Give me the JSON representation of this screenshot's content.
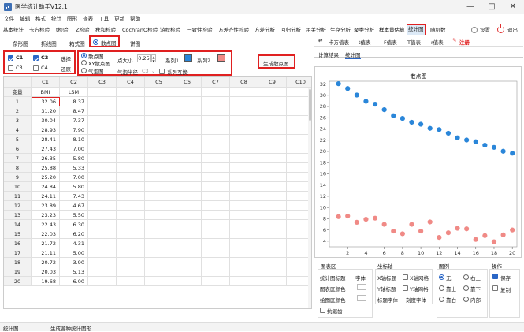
{
  "app": {
    "title": "医学统计助手V12.1"
  },
  "window_controls": {
    "minimize": "—",
    "maximize": "□",
    "close": "✕"
  },
  "menu": [
    "文件",
    "编辑",
    "格式",
    "统计",
    "图形",
    "查表",
    "工具",
    "更新",
    "帮助"
  ],
  "toolbar": {
    "items": [
      "基本统计",
      "卡方检验",
      "t检验",
      "Z检验",
      "秩和检验",
      "CochranQ检验",
      "游程检验",
      "一致性检验",
      "方差齐性检验",
      "方差分析",
      "回归分析",
      "相关分析",
      "生存分析",
      "聚类分析",
      "样本量估算",
      "统计图",
      "随机数"
    ],
    "active": "统计图",
    "settings_label": "设置",
    "exit_label": "退出"
  },
  "chart_tabs": {
    "items": [
      "条形图",
      "折线图",
      "箱式图",
      "散点图",
      "饼图"
    ],
    "active": "散点图"
  },
  "options": {
    "c1": "C1",
    "c2": "C2",
    "c3": "C3",
    "c4": "C4",
    "select_label": "选择",
    "restore_label": "还原",
    "type_scatter": "散点图",
    "type_xy": "XY散点图",
    "type_bubble": "气泡图",
    "point_size_label": "点大小",
    "point_size_value": "0.25",
    "series1_label": "系列1",
    "series2_label": "系列2",
    "bubble_radius_label": "气泡半径",
    "bubble_radius_value": "C3",
    "swap_label": "系列互换",
    "generate_label": "生成散点图",
    "series1_color": "#2a86d9",
    "series2_color": "#f08a86"
  },
  "table": {
    "columns": [
      "C1",
      "C2",
      "C3",
      "C4",
      "C5",
      "C6",
      "C7",
      "C8",
      "C9",
      "C10"
    ],
    "var_label": "变量",
    "var_names": [
      "BMI",
      "LSM"
    ],
    "rows": [
      [
        "1",
        "32.06",
        "8.37"
      ],
      [
        "2",
        "31.20",
        "8.47"
      ],
      [
        "3",
        "30.04",
        "7.37"
      ],
      [
        "4",
        "28.93",
        "7.90"
      ],
      [
        "5",
        "28.41",
        "8.10"
      ],
      [
        "6",
        "27.43",
        "7.00"
      ],
      [
        "7",
        "26.35",
        "5.80"
      ],
      [
        "8",
        "25.88",
        "5.33"
      ],
      [
        "9",
        "25.20",
        "7.00"
      ],
      [
        "10",
        "24.84",
        "5.80"
      ],
      [
        "11",
        "24.11",
        "7.43"
      ],
      [
        "12",
        "23.89",
        "4.67"
      ],
      [
        "13",
        "23.23",
        "5.50"
      ],
      [
        "14",
        "22.43",
        "6.30"
      ],
      [
        "15",
        "22.03",
        "6.20"
      ],
      [
        "16",
        "21.72",
        "4.31"
      ],
      [
        "17",
        "21.11",
        "5.00"
      ],
      [
        "18",
        "20.72",
        "3.90"
      ],
      [
        "19",
        "20.03",
        "5.13"
      ],
      [
        "20",
        "19.68",
        "6.00"
      ]
    ]
  },
  "right_panel": {
    "tabs": [
      "卡方值表",
      "t值表",
      "F值表",
      "T值表",
      "r值表"
    ],
    "register_label": "注册",
    "subtabs": [
      "计算结果",
      "统计图"
    ],
    "active_subtab": "统计图"
  },
  "chart_data": {
    "type": "scatter",
    "title": "散点图",
    "xlim": [
      0,
      20.5
    ],
    "ylim": [
      3,
      32.5
    ],
    "x_ticks": [
      2,
      4,
      6,
      8,
      10,
      12,
      14,
      16,
      18,
      20
    ],
    "y_ticks": [
      4,
      6,
      8,
      10,
      12,
      14,
      16,
      18,
      20,
      22,
      24,
      26,
      28,
      30,
      32
    ],
    "grid": false,
    "series": [
      {
        "color": "#2a86d9",
        "x": [
          1,
          2,
          3,
          4,
          5,
          6,
          7,
          8,
          9,
          10,
          11,
          12,
          13,
          14,
          15,
          16,
          17,
          18,
          19,
          20
        ],
        "y": [
          32.06,
          31.2,
          30.04,
          28.93,
          28.41,
          27.43,
          26.35,
          25.88,
          25.2,
          24.84,
          24.11,
          23.89,
          23.23,
          22.43,
          22.03,
          21.72,
          21.11,
          20.72,
          20.03,
          19.68
        ]
      },
      {
        "color": "#f08a86",
        "x": [
          1,
          2,
          3,
          4,
          5,
          6,
          7,
          8,
          9,
          10,
          11,
          12,
          13,
          14,
          15,
          16,
          17,
          18,
          19,
          20
        ],
        "y": [
          8.37,
          8.47,
          7.37,
          7.9,
          8.1,
          7.0,
          5.8,
          5.33,
          7.0,
          5.8,
          7.43,
          4.67,
          5.5,
          6.3,
          6.2,
          4.31,
          5.0,
          3.9,
          5.13,
          6.0
        ]
      }
    ]
  },
  "chart_settings": {
    "chart_area_title": "图表区",
    "stat_title_label": "统计图标题",
    "font_label": "字体",
    "chart_color_label": "图表区颜色",
    "plot_color_label": "绘图区颜色",
    "antialias_label": "抗锯齿",
    "axis_title": "坐标轴",
    "x_title_label": "X轴标题",
    "x_grid_label": "X轴网格",
    "y_title_label": "Y轴标题",
    "y_grid_label": "Y轴网格",
    "axis_title_font": "标题字体",
    "tick_font": "刻度字体",
    "legend_title": "图例",
    "legend_none": "无",
    "legend_right_top": "右上",
    "legend_top": "靠上",
    "legend_bottom": "靠下",
    "legend_right": "靠右",
    "legend_inside": "内部",
    "ops_title": "操作",
    "save_label": "保存",
    "copy_label": "复制"
  },
  "status": {
    "left": "统计图",
    "message": "生成各种统计图形"
  }
}
